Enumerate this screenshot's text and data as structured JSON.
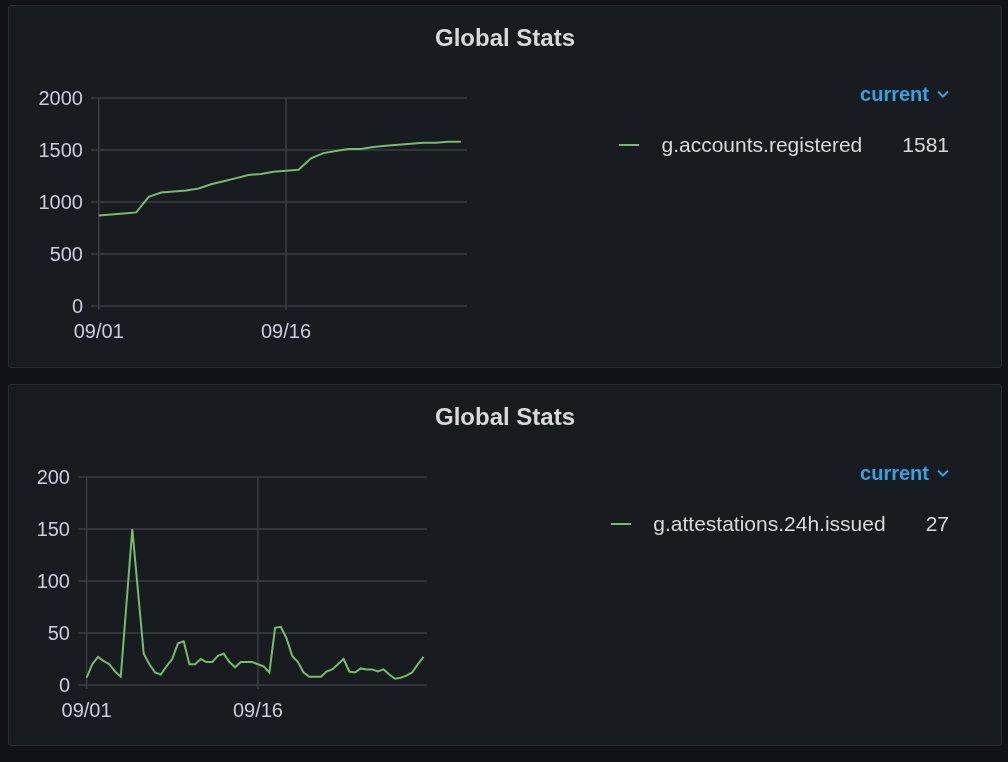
{
  "panels": [
    {
      "title": "Global Stats",
      "legend": {
        "header": "current",
        "items": [
          {
            "value": "1581"
          }
        ]
      },
      "chart_data": {
        "type": "line",
        "categories": [
          "09/01",
          null,
          null,
          null,
          null,
          null,
          null,
          null,
          null,
          null,
          null,
          null,
          null,
          null,
          null,
          "09/16",
          null,
          null,
          null,
          null,
          null,
          null,
          null,
          null,
          null,
          null,
          null,
          null,
          null,
          null
        ],
        "series": [
          {
            "name": "g.accounts.registered",
            "color": "#73bf69",
            "values": [
              870,
              880,
              890,
              900,
              1050,
              1090,
              1100,
              1110,
              1130,
              1170,
              1200,
              1230,
              1260,
              1270,
              1290,
              1300,
              1310,
              1420,
              1470,
              1490,
              1510,
              1510,
              1530,
              1540,
              1550,
              1560,
              1570,
              1570,
              1580,
              1580
            ]
          }
        ],
        "ylim": [
          0,
          2000
        ],
        "grid": true,
        "yticks": [
          0,
          500,
          1000,
          1500,
          2000
        ]
      }
    },
    {
      "title": "Global Stats",
      "legend": {
        "header": "current",
        "items": [
          {
            "value": "27"
          }
        ]
      },
      "chart_data": {
        "type": "line",
        "categories": [
          "09/01",
          null,
          null,
          null,
          null,
          null,
          null,
          null,
          null,
          null,
          null,
          null,
          null,
          null,
          null,
          null,
          null,
          null,
          null,
          null,
          null,
          null,
          null,
          null,
          null,
          null,
          null,
          null,
          null,
          null,
          "09/16",
          null,
          null,
          null,
          null,
          null,
          null,
          null,
          null,
          null,
          null,
          null,
          null,
          null,
          null,
          null,
          null,
          null,
          null,
          null,
          null,
          null,
          null,
          null,
          null,
          null,
          null,
          null,
          null,
          null
        ],
        "series": [
          {
            "name": "g.attestations.24h.issued",
            "color": "#73bf69",
            "values": [
              7,
              20,
              27,
              23,
              20,
              13,
              8,
              80,
              150,
              90,
              30,
              20,
              12,
              10,
              18,
              25,
              40,
              42,
              20,
              20,
              25,
              22,
              22,
              28,
              30,
              22,
              17,
              22,
              22,
              22,
              20,
              18,
              12,
              55,
              56,
              45,
              28,
              22,
              12,
              8,
              8,
              8,
              13,
              15,
              20,
              25,
              13,
              12,
              16,
              15,
              15,
              13,
              15,
              10,
              6,
              7,
              9,
              12,
              20,
              27
            ]
          }
        ],
        "ylim": [
          0,
          200
        ],
        "grid": true,
        "yticks": [
          0,
          50,
          100,
          150,
          200
        ]
      }
    }
  ]
}
